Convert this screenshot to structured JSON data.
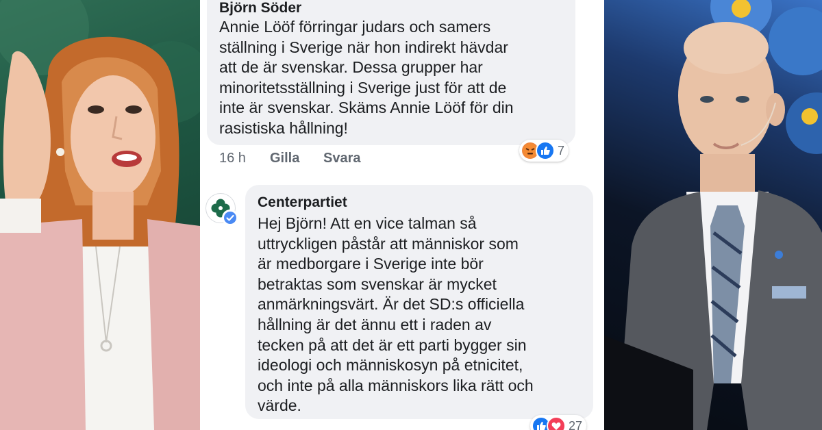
{
  "comments": [
    {
      "author": "Björn Söder",
      "text": "Annie Lööf förringar judars och samers\nställning i Sverige när hon indirekt hävdar\natt de är svenskar. Dessa grupper har\nminoritetsställning i Sverige just för att de\ninte är svenskar. Skäms Annie Lööf för din\nrasistiska hållning!",
      "time": "16 h",
      "like_label": "Gilla",
      "reply_label": "Svara",
      "reaction_icons": [
        "angry-icon",
        "like-icon"
      ],
      "reaction_count": "7"
    },
    {
      "author": "Centerpartiet",
      "verified": true,
      "text": "Hej Björn! Att en vice talman så\nuttryckligen påstår att människor som\när medborgare i Sverige inte bör\nbetraktas som svenskar är mycket\nanmärkningsvärt. Är det SD:s officiella\nhållning är det ännu ett i raden av\ntecken på att det är ett parti bygger sin\nideologi och människosyn på etnicitet,\noch inte på alla människors lika rätt och\nvärde.",
      "reaction_icons": [
        "like-icon",
        "love-icon"
      ],
      "reaction_count": "27",
      "avatar_icon": "clover-logo-icon"
    }
  ],
  "colors": {
    "bubble": "#f0f1f4",
    "text": "#1c1e21",
    "meta": "#606770",
    "like_blue": "#1877f2",
    "angry_orange": "#f0873c",
    "love_red": "#f33e58",
    "party_green": "#1d6b4a",
    "verified_blue": "#4a8af4"
  }
}
